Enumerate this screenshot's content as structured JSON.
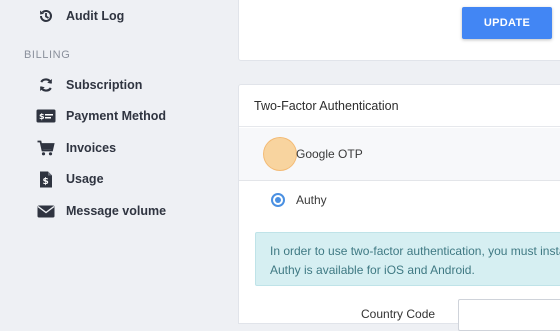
{
  "sidebar": {
    "audit_log": "Audit Log",
    "section_billing": "BILLING",
    "items": [
      {
        "label": "Subscription",
        "icon": "refresh-icon"
      },
      {
        "label": "Payment Method",
        "icon": "credit-card-icon"
      },
      {
        "label": "Invoices",
        "icon": "cart-icon"
      },
      {
        "label": "Usage",
        "icon": "dollar-document-icon"
      },
      {
        "label": "Message volume",
        "icon": "envelope-icon"
      }
    ]
  },
  "top_card": {
    "update_label": "UPDATE"
  },
  "two_factor": {
    "title": "Two-Factor Authentication",
    "options": [
      {
        "label": "Google OTP",
        "selected": false
      },
      {
        "label": "Authy",
        "selected": true
      }
    ],
    "info_line1": "In order to use two-factor authentication, you must insta",
    "info_line2": "Authy is available for iOS and Android.",
    "country_code_label": "Country Code",
    "country_code_value": ""
  },
  "colors": {
    "accent": "#4286f4",
    "info_bg": "#d6eff2",
    "info_text": "#3f7983",
    "sidebar_bg": "#eef0f4"
  }
}
